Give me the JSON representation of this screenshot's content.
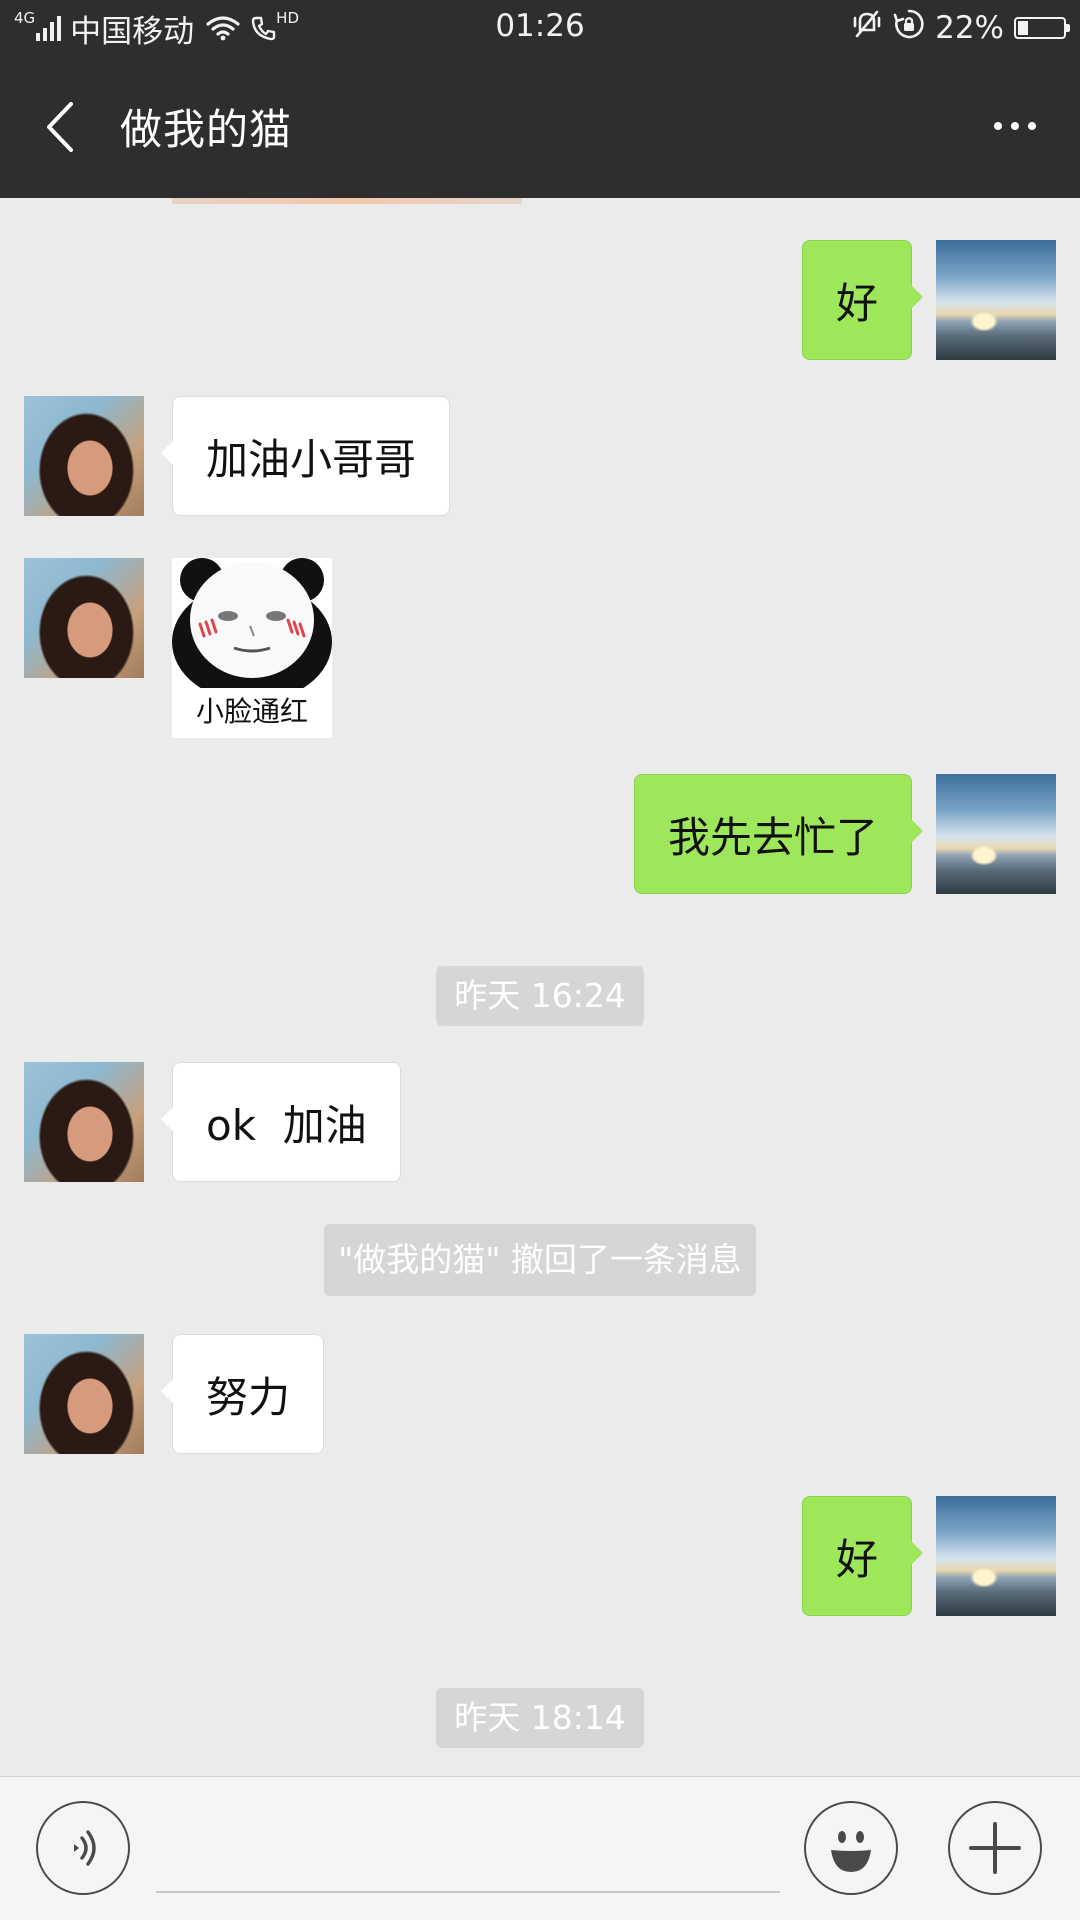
{
  "status_bar": {
    "network_type": "4G",
    "carrier": "中国移动",
    "hd_badge": "HD",
    "time": "01:26",
    "battery_percent": "22%",
    "battery_level": 0.22,
    "icons": [
      "signal-icon",
      "wifi-icon",
      "hd-call-icon",
      "vibrate-mute-icon",
      "rotation-lock-icon",
      "battery-icon"
    ]
  },
  "header": {
    "title": "做我的猫",
    "back_icon": "chevron-left-icon",
    "more_icon": "more-dots-icon"
  },
  "messages": [
    {
      "type": "text",
      "side": "right",
      "text": "好"
    },
    {
      "type": "text",
      "side": "left",
      "text": "加油小哥哥"
    },
    {
      "type": "sticker",
      "side": "left",
      "caption": "小脸通红"
    },
    {
      "type": "text",
      "side": "right",
      "text": "我先去忙了"
    },
    {
      "type": "time",
      "text": "昨天 16:24"
    },
    {
      "type": "text",
      "side": "left",
      "text": "ok  加油"
    },
    {
      "type": "system",
      "text": "\"做我的猫\" 撤回了一条消息"
    },
    {
      "type": "text",
      "side": "left",
      "text": "努力"
    },
    {
      "type": "text",
      "side": "right",
      "text": "好"
    },
    {
      "type": "time",
      "text": "昨天 18:14"
    }
  ],
  "input_bar": {
    "value": "",
    "voice_icon": "voice-icon",
    "emoji_icon": "emoji-icon",
    "plus_icon": "plus-icon"
  },
  "colors": {
    "header_bg": "#2e2e2e",
    "chat_bg": "#ebebeb",
    "outgoing_bubble": "#9ee65a",
    "incoming_bubble": "#ffffff",
    "system_pill": "#d6d6d6"
  }
}
